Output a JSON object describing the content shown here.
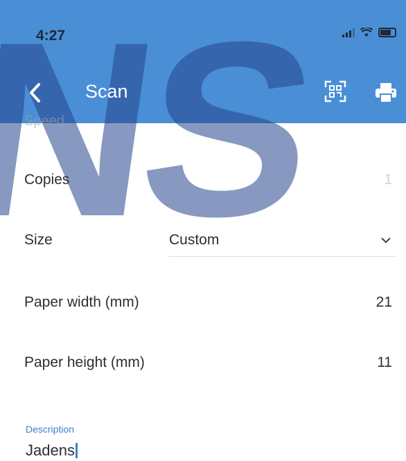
{
  "status_bar": {
    "time": "4:27"
  },
  "header": {
    "title": "Scan"
  },
  "form": {
    "cut_off_label": "Speed",
    "copies": {
      "label": "Copies",
      "value": "1"
    },
    "size": {
      "label": "Size",
      "selected": "Custom"
    },
    "paper_width": {
      "label": "Paper width (mm)",
      "value": "21"
    },
    "paper_height": {
      "label": "Paper height (mm)",
      "value": "11"
    },
    "description": {
      "label": "Description",
      "value": "Jadens"
    }
  },
  "watermark": {
    "text": "NS"
  },
  "colors": {
    "header": "#4a8fd6",
    "accent": "#3f7fd0"
  }
}
